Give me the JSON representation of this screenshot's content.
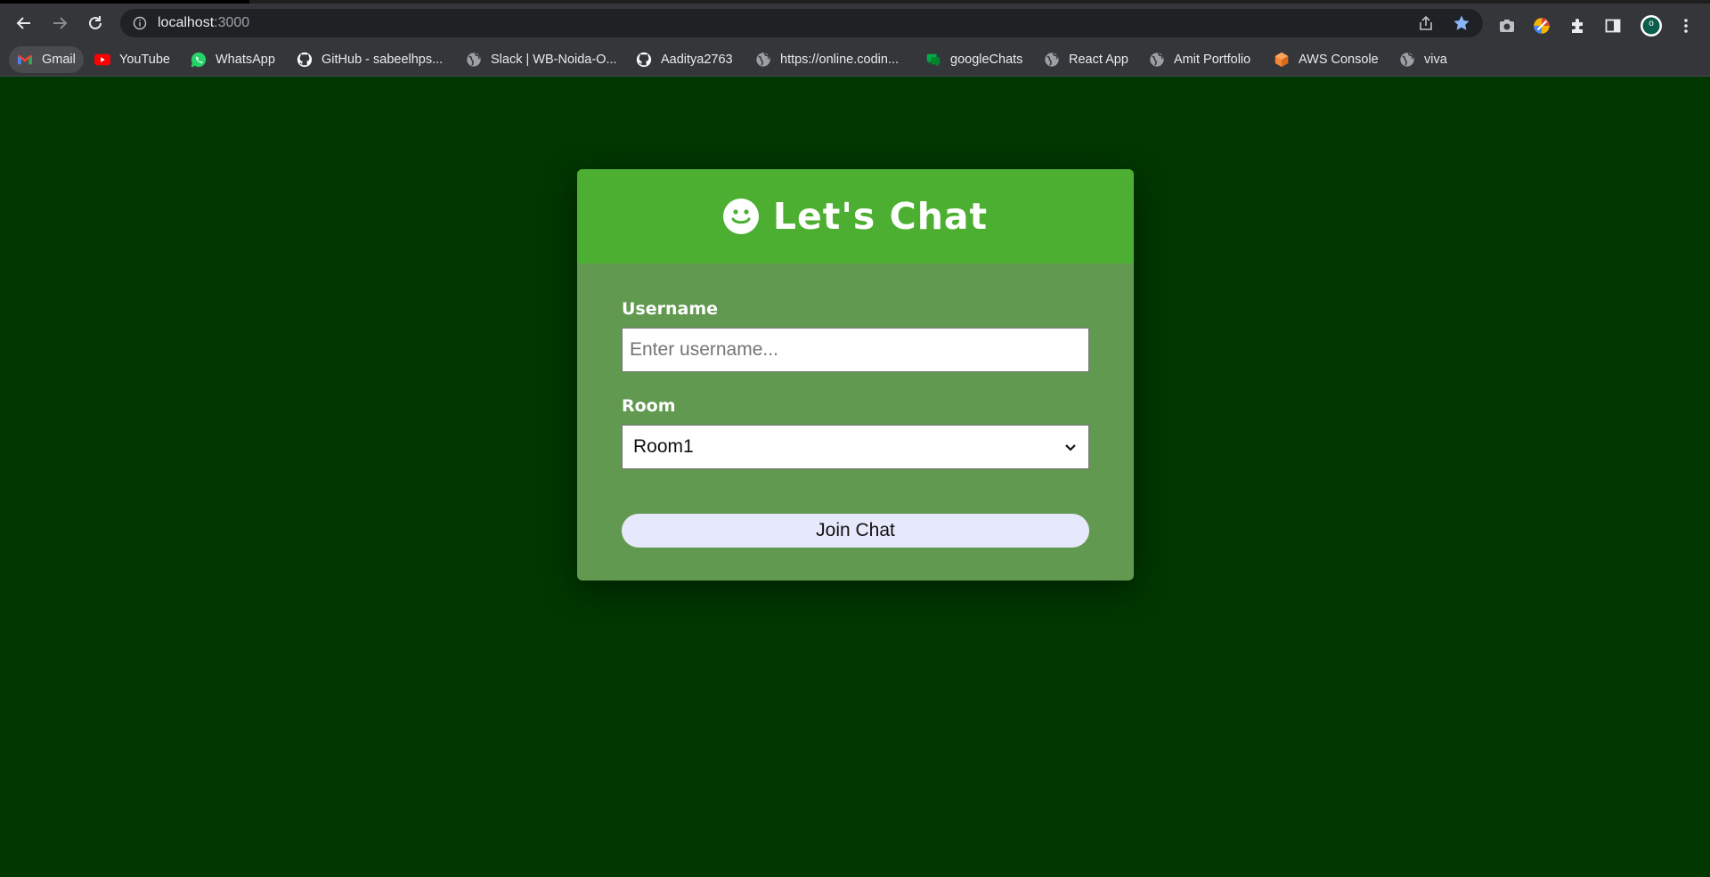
{
  "browser": {
    "url_host": "localhost",
    "url_port": ":3000",
    "bookmarks": [
      {
        "label": "Gmail",
        "icon": "gmail-icon"
      },
      {
        "label": "YouTube",
        "icon": "youtube-icon"
      },
      {
        "label": "WhatsApp",
        "icon": "whatsapp-icon"
      },
      {
        "label": "GitHub - sabeelhps...",
        "icon": "github-icon"
      },
      {
        "label": "Slack | WB-Noida-O...",
        "icon": "globe-icon"
      },
      {
        "label": "Aaditya2763",
        "icon": "github-icon"
      },
      {
        "label": "https://online.codin...",
        "icon": "globe-icon"
      },
      {
        "label": "googleChats",
        "icon": "google-chat-icon"
      },
      {
        "label": "React App",
        "icon": "globe-icon"
      },
      {
        "label": "Amit Portfolio",
        "icon": "globe-icon"
      },
      {
        "label": "AWS Console",
        "icon": "aws-icon"
      },
      {
        "label": "viva",
        "icon": "globe-icon"
      }
    ],
    "profile_initial": "o"
  },
  "colors": {
    "page_background": "#013701",
    "card_header": "#4caf31",
    "card_body": "#629951",
    "join_button": "#e6e8fb"
  },
  "form": {
    "title": "Let's Chat",
    "username_label": "Username",
    "username_placeholder": "Enter username...",
    "username_value": "",
    "room_label": "Room",
    "room_selected": "Room1",
    "join_label": "Join Chat"
  }
}
